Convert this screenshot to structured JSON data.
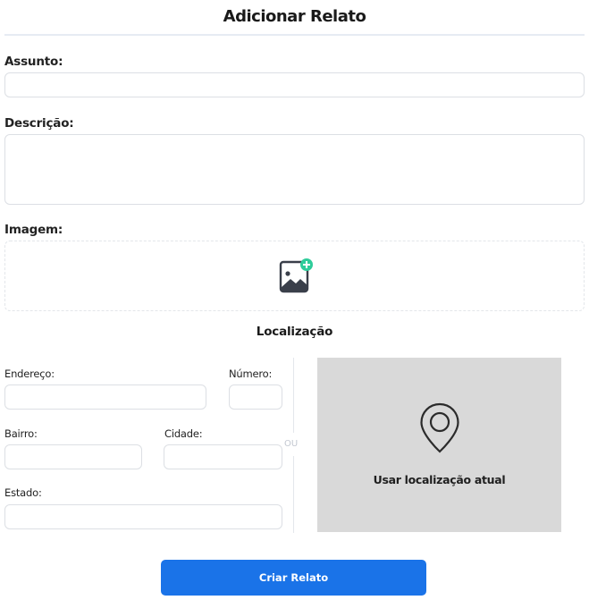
{
  "page": {
    "title": "Adicionar Relato"
  },
  "form": {
    "subject_label": "Assunto:",
    "subject_value": "",
    "description_label": "Descrição:",
    "description_value": "",
    "image_label": "Imagem:",
    "image_icon": "add-image-icon"
  },
  "location": {
    "title": "Localização",
    "address_label": "Endereço:",
    "number_label": "Número:",
    "neighborhood_label": "Bairro:",
    "city_label": "Cidade:",
    "state_label": "Estado:",
    "or_text": "OU",
    "use_current_label": "Usar localização atual",
    "pin_icon": "location-pin-icon"
  },
  "actions": {
    "submit_label": "Criar Relato"
  },
  "colors": {
    "accent": "#1a73e8",
    "add_badge": "#2ecc9a",
    "map_bg": "#d9d9d9",
    "icon": "#3a3f4a"
  }
}
